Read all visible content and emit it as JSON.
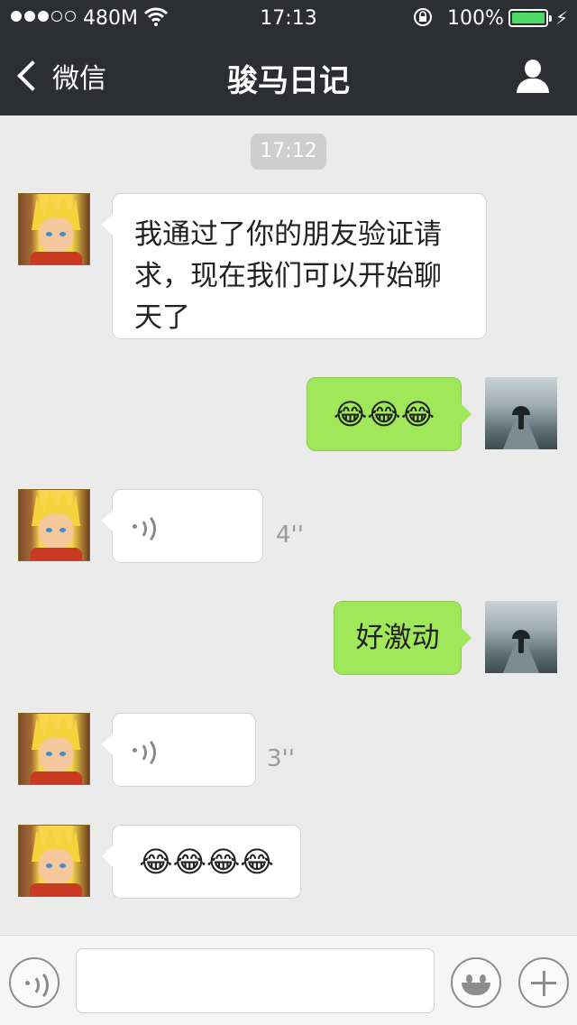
{
  "status_bar": {
    "carrier": "480M",
    "time": "17:13",
    "battery": "100%",
    "battery_level": 1.0,
    "signal_bars_filled": 3,
    "signal_bars_total": 5,
    "battery_color": "#4cd964"
  },
  "nav": {
    "back_label": "微信",
    "title": "骏马日记",
    "right_icon": "person-icon"
  },
  "chat": {
    "timestamp": "17:12",
    "messages": [
      {
        "side": "left",
        "type": "text",
        "text": "我通过了你的朋友验证请求，现在我们可以开始聊天了"
      },
      {
        "side": "right",
        "type": "emoji",
        "text": "😂😂😂"
      },
      {
        "side": "left",
        "type": "voice",
        "duration": "4''"
      },
      {
        "side": "right",
        "type": "text",
        "text": "好激动"
      },
      {
        "side": "left",
        "type": "voice",
        "duration": "3''"
      },
      {
        "side": "left",
        "type": "emoji",
        "text": "😂😂😂😂"
      }
    ]
  },
  "colors": {
    "nav_bg": "#2d2e32",
    "chat_bg": "#ebebeb",
    "bubble_right": "#a0e75a",
    "bubble_left": "#ffffff"
  },
  "input_bar": {
    "voice_icon": "voice-icon",
    "emoji_icon": "smiley-icon",
    "more_icon": "plus-icon"
  }
}
